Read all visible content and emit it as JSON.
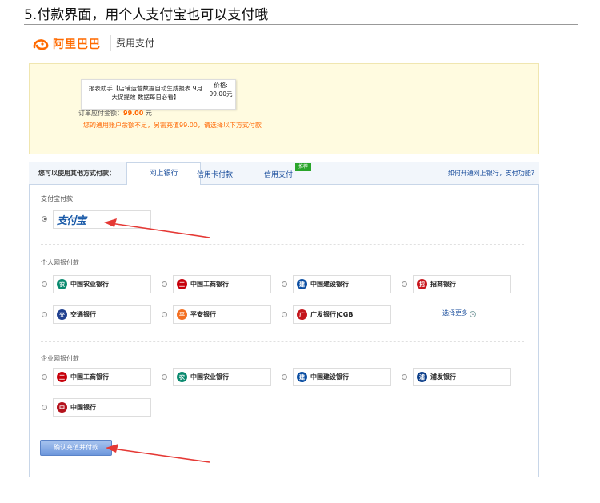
{
  "heading": "5.付款界面，用个人支付宝也可以支付哦",
  "brand": {
    "logo_text": "阿里巴巴",
    "subtitle": "费用支付",
    "accent": "#ff6a00"
  },
  "order": {
    "product": "报表助手【店铺运营数据自动生成报表 9月大促提效 数据每日必看】",
    "price_label": "价格: 99.00元",
    "payable_label": "订单应付金额：",
    "payable_amount": "99.00",
    "payable_unit": "元",
    "balance_notice": "您的通用账户余额不足，另需充值99.00，请选择以下方式付款"
  },
  "tabs": {
    "prompt": "您可以使用其他方式付款：",
    "items": [
      {
        "label": "网上银行"
      },
      {
        "label": "信用卡付款"
      },
      {
        "label": "信用支付"
      }
    ],
    "recommend_badge": "推荐",
    "help_link": "如何开通网上银行，支付功能?"
  },
  "alipay_section": {
    "title": "支付宝付款",
    "option": "支付宝"
  },
  "personal_section": {
    "title": "个人网银付款",
    "banks": [
      {
        "name": "中国农业银行",
        "icon": "abc-bank-icon",
        "color": "#0a8a6f",
        "glyph": "农"
      },
      {
        "name": "中国工商银行",
        "icon": "icbc-bank-icon",
        "color": "#c7000b",
        "glyph": "工"
      },
      {
        "name": "中国建设银行",
        "icon": "ccb-bank-icon",
        "color": "#0b4ea2",
        "glyph": "建"
      },
      {
        "name": "招商银行",
        "icon": "cmb-bank-icon",
        "color": "#c8161d",
        "glyph": "招"
      },
      {
        "name": "交通银行",
        "icon": "bocom-bank-icon",
        "color": "#1f3f8f",
        "glyph": "交"
      },
      {
        "name": "平安银行",
        "icon": "pingan-bank-icon",
        "color": "#f36f21",
        "glyph": "平"
      },
      {
        "name": "广发银行|CGB",
        "icon": "cgb-bank-icon",
        "color": "#c4161c",
        "glyph": "广"
      }
    ],
    "more_label": "选择更多"
  },
  "enterprise_section": {
    "title": "企业网银付款",
    "banks": [
      {
        "name": "中国工商银行",
        "icon": "icbc-bank-icon",
        "color": "#c7000b",
        "glyph": "工"
      },
      {
        "name": "中国农业银行",
        "icon": "abc-bank-icon",
        "color": "#0a8a6f",
        "glyph": "农"
      },
      {
        "name": "中国建设银行",
        "icon": "ccb-bank-icon",
        "color": "#0b4ea2",
        "glyph": "建"
      },
      {
        "name": "浦发银行",
        "icon": "spdb-bank-icon",
        "color": "#0d3f8a",
        "glyph": "浦"
      },
      {
        "name": "中国银行",
        "icon": "boc-bank-icon",
        "color": "#b4121c",
        "glyph": "中"
      }
    ]
  },
  "confirm_button": "确认充值并付款",
  "annotation_color": "#e53935"
}
